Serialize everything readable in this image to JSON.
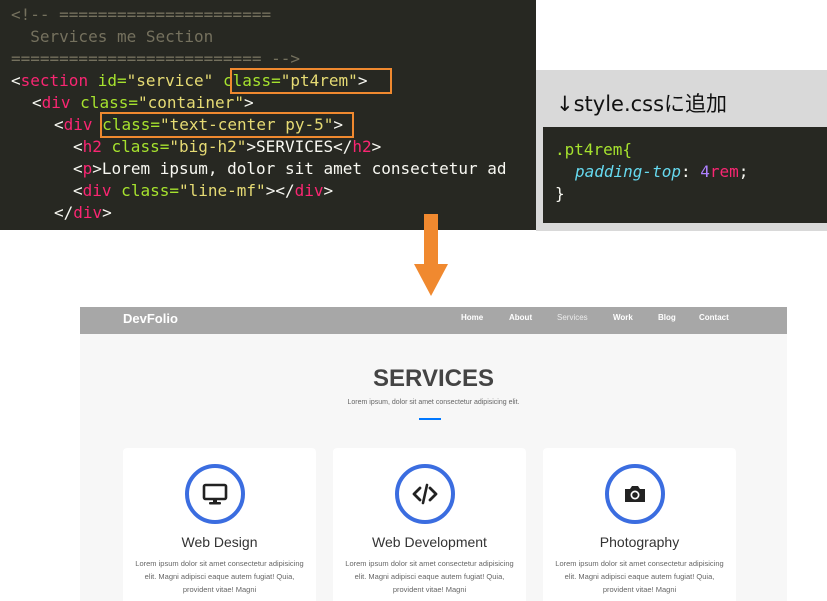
{
  "code": {
    "c1": "<!-- ======================",
    "c2": "  Services me Section",
    "c3": "========================== -->",
    "l4": {
      "lt": "<",
      "tag": "section",
      "attr1": " id=",
      "val1": "\"service\"",
      "attr2": " class=",
      "val2": "\"pt4rem\"",
      "gt": ">"
    },
    "l5": {
      "lt": "<",
      "tag": "div",
      "attr": " class=",
      "val": "\"container\"",
      "gt": ">"
    },
    "l6": {
      "lt": "<",
      "tag": "div",
      "attr": " class=",
      "val": "\"text-center py-5\"",
      "gt": ">"
    },
    "l7": {
      "lt": "<",
      "tag": "h2",
      "attr": " class=",
      "val": "\"big-h2\"",
      "gt": ">",
      "text": "SERVICES",
      "close_lt": "</",
      "close_tag": "h2",
      "close_gt": ">"
    },
    "l8": {
      "lt": "<",
      "tag": "p",
      "gt": ">",
      "text": "Lorem ipsum, dolor sit amet consectetur ad"
    },
    "l9": {
      "lt": "<",
      "tag": "div",
      "attr": " class=",
      "val": "\"line-mf\"",
      "gt": ">",
      "close_lt": "</",
      "close_tag": "div",
      "close_gt": ">"
    },
    "l10": {
      "lt": "</",
      "tag": "div",
      "gt": ">"
    }
  },
  "note": {
    "title": "↓style.cssに追加",
    "css_selector": ".pt4rem{",
    "css_prop": "padding-top",
    "css_colon": ": ",
    "css_num": "4",
    "css_unit": "rem",
    "css_semi": ";",
    "css_close": "}"
  },
  "colors": {
    "highlight": "#f0892f",
    "arrow": "#f0892f",
    "accent": "#3b6de0"
  },
  "site": {
    "brand": "DevFolio",
    "nav": [
      "Home",
      "About",
      "Services",
      "Work",
      "Blog",
      "Contact"
    ],
    "title": "SERVICES",
    "subtitle": "Lorem ipsum, dolor sit amet consectetur adipisicing elit.",
    "cards": [
      {
        "icon": "monitor-icon",
        "title": "Web Design",
        "text": "Lorem ipsum dolor sit amet consectetur adipisicing elit. Magni adipisci eaque autem fugiat! Quia, provident vitae! Magni"
      },
      {
        "icon": "code-icon",
        "title": "Web Development",
        "text": "Lorem ipsum dolor sit amet consectetur adipisicing elit. Magni adipisci eaque autem fugiat! Quia, provident vitae! Magni"
      },
      {
        "icon": "camera-icon",
        "title": "Photography",
        "text": "Lorem ipsum dolor sit amet consectetur adipisicing elit. Magni adipisci eaque autem fugiat! Quia, provident vitae! Magni"
      }
    ]
  }
}
